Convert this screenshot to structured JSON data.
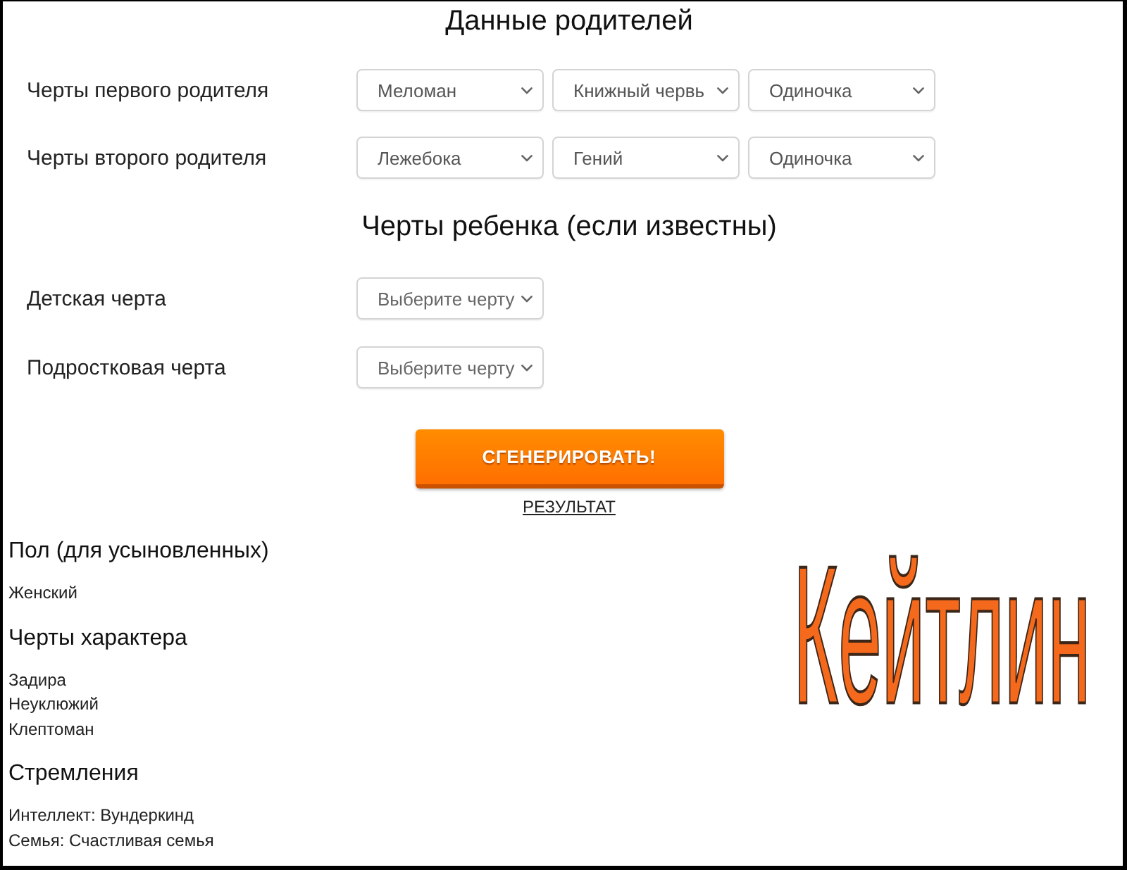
{
  "parents": {
    "title": "Данные родителей",
    "rows": [
      {
        "label": "Черты первого родителя",
        "selects": [
          "Меломан",
          "Книжный червь",
          "Одиночка"
        ]
      },
      {
        "label": "Черты второго родителя",
        "selects": [
          "Лежебока",
          "Гений",
          "Одиночка"
        ]
      }
    ]
  },
  "child": {
    "title": "Черты ребенка (если известны)",
    "rows": [
      {
        "label": "Детская черта",
        "select": {
          "placeholder": "Выберите черту"
        }
      },
      {
        "label": "Подростковая черта",
        "select": {
          "placeholder": "Выберите черту"
        }
      }
    ]
  },
  "generate_button": {
    "label": "СГЕНЕРИРОВАТЬ!"
  },
  "result_link": {
    "label": "РЕЗУЛЬТАТ"
  },
  "results": {
    "sections": [
      {
        "heading": "Пол (для усыновленных)",
        "items": [
          "Женский"
        ]
      },
      {
        "heading": "Черты характера",
        "items": [
          "Задира",
          "Неуклюжий",
          "Клептоман"
        ]
      },
      {
        "heading": "Стремления",
        "items": [
          "Интеллект: Вундеркинд",
          "Семья: Счастливая семья"
        ]
      }
    ],
    "name": "Кейтлин"
  }
}
